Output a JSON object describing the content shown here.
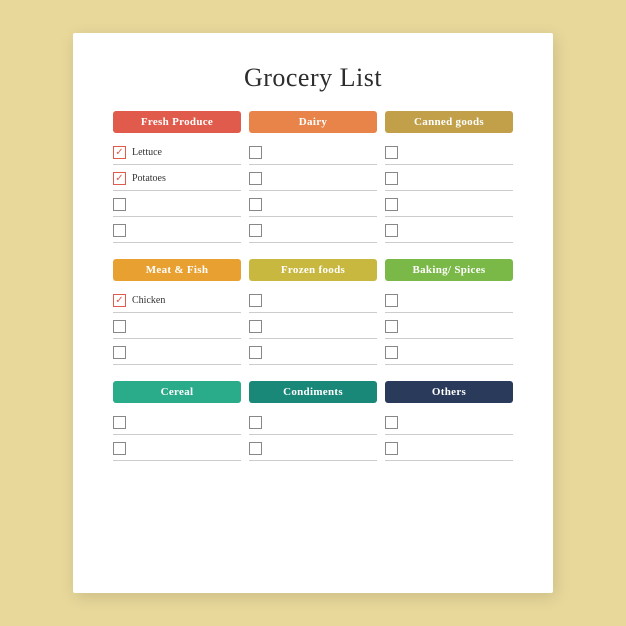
{
  "title": "Grocery List",
  "sections": [
    {
      "categories": [
        {
          "label": "Fresh Produce",
          "color_class": "fresh-produce"
        },
        {
          "label": "Dairy",
          "color_class": "dairy"
        },
        {
          "label": "Canned goods",
          "color_class": "canned-goods"
        }
      ],
      "rows": [
        [
          {
            "checked": true,
            "label": "Lettuce"
          },
          {
            "checked": false,
            "label": ""
          },
          {
            "checked": false,
            "label": ""
          }
        ],
        [
          {
            "checked": true,
            "label": "Potatoes"
          },
          {
            "checked": false,
            "label": ""
          },
          {
            "checked": false,
            "label": ""
          }
        ],
        [
          {
            "checked": false,
            "label": ""
          },
          {
            "checked": false,
            "label": ""
          },
          {
            "checked": false,
            "label": ""
          }
        ],
        [
          {
            "checked": false,
            "label": ""
          },
          {
            "checked": false,
            "label": ""
          },
          {
            "checked": false,
            "label": ""
          }
        ]
      ]
    },
    {
      "categories": [
        {
          "label": "Meat & Fish",
          "color_class": "meat-fish"
        },
        {
          "label": "Frozen foods",
          "color_class": "frozen-foods"
        },
        {
          "label": "Baking/ Spices",
          "color_class": "baking-spices"
        }
      ],
      "rows": [
        [
          {
            "checked": true,
            "label": "Chicken"
          },
          {
            "checked": false,
            "label": ""
          },
          {
            "checked": false,
            "label": ""
          }
        ],
        [
          {
            "checked": false,
            "label": ""
          },
          {
            "checked": false,
            "label": ""
          },
          {
            "checked": false,
            "label": ""
          }
        ],
        [
          {
            "checked": false,
            "label": ""
          },
          {
            "checked": false,
            "label": ""
          },
          {
            "checked": false,
            "label": ""
          }
        ]
      ]
    },
    {
      "categories": [
        {
          "label": "Cereal",
          "color_class": "cereal"
        },
        {
          "label": "Condiments",
          "color_class": "condiments"
        },
        {
          "label": "Others",
          "color_class": "others"
        }
      ],
      "rows": [
        [
          {
            "checked": false,
            "label": ""
          },
          {
            "checked": false,
            "label": ""
          },
          {
            "checked": false,
            "label": ""
          }
        ],
        [
          {
            "checked": false,
            "label": ""
          },
          {
            "checked": false,
            "label": ""
          },
          {
            "checked": false,
            "label": ""
          }
        ]
      ]
    }
  ]
}
